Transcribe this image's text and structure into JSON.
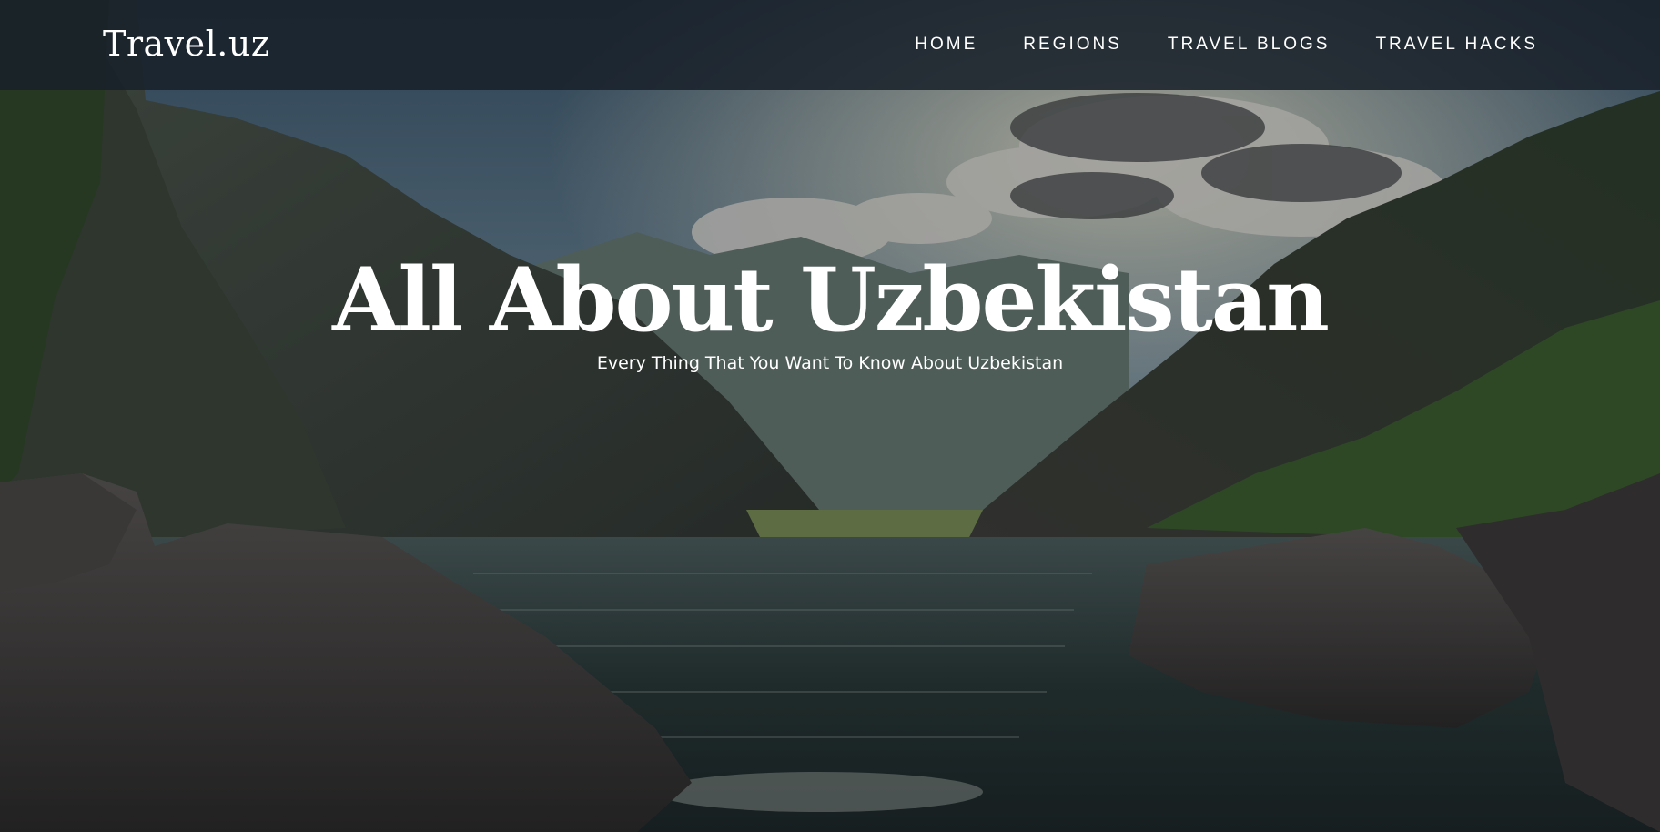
{
  "header": {
    "logo": "Travel.uz",
    "nav": [
      {
        "label": "HOME"
      },
      {
        "label": "REGIONS"
      },
      {
        "label": "TRAVEL BLOGS"
      },
      {
        "label": "TRAVEL HACKS"
      }
    ]
  },
  "hero": {
    "title": "All About Uzbekistan",
    "subtitle": "Every Thing That You Want To Know About Uzbekistan",
    "background_image": "mountain-lake-landscape"
  },
  "colors": {
    "navbar_bg": "#18212a",
    "text": "#ffffff"
  }
}
